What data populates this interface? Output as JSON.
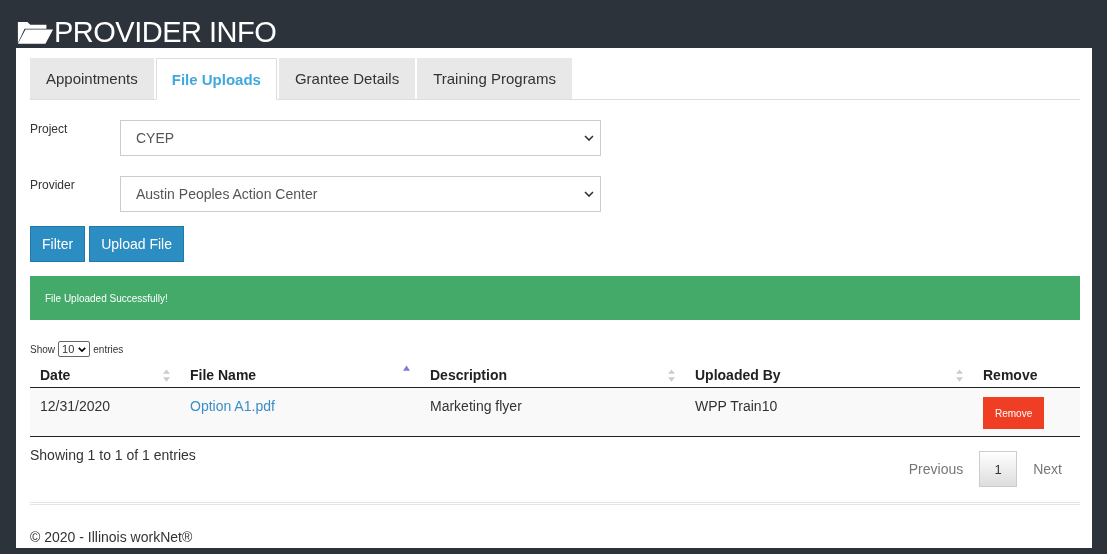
{
  "header": {
    "title": "PROVIDER INFO"
  },
  "tabs": [
    {
      "label": "Appointments",
      "selected": false
    },
    {
      "label": "File Uploads",
      "selected": true
    },
    {
      "label": "Grantee Details",
      "selected": false
    },
    {
      "label": "Training Programs",
      "selected": false
    }
  ],
  "form": {
    "fields": [
      {
        "label": "Project",
        "value": "CYEP"
      },
      {
        "label": "Provider",
        "value": "Austin Peoples Action Center"
      }
    ],
    "buttons": [
      "Filter",
      "Upload File"
    ]
  },
  "alert": {
    "message": "File Uploaded Successfully!"
  },
  "table": {
    "length_label_before": "Show",
    "length_value": "10",
    "length_label_after": "entries",
    "columns": [
      {
        "label": "Date",
        "sortable": true,
        "sorted": false
      },
      {
        "label": "File Name",
        "sortable": true,
        "sorted": true
      },
      {
        "label": "Description",
        "sortable": true,
        "sorted": false
      },
      {
        "label": "Uploaded By",
        "sortable": true,
        "sorted": false
      },
      {
        "label": "Remove",
        "sortable": false
      }
    ],
    "rows": [
      {
        "date": "12/31/2020",
        "file_name": "Option A1.pdf",
        "description": "Marketing flyer",
        "uploaded_by": "WPP Train10",
        "remove": "Remove"
      }
    ],
    "info": "Showing 1 to 1 of 1 entries",
    "pager": {
      "previous": "Previous",
      "pages": [
        {
          "label": "1",
          "selected": true
        }
      ],
      "next": "Next"
    }
  },
  "footer": {
    "text": "© 2020 - Illinois workNet®"
  }
}
